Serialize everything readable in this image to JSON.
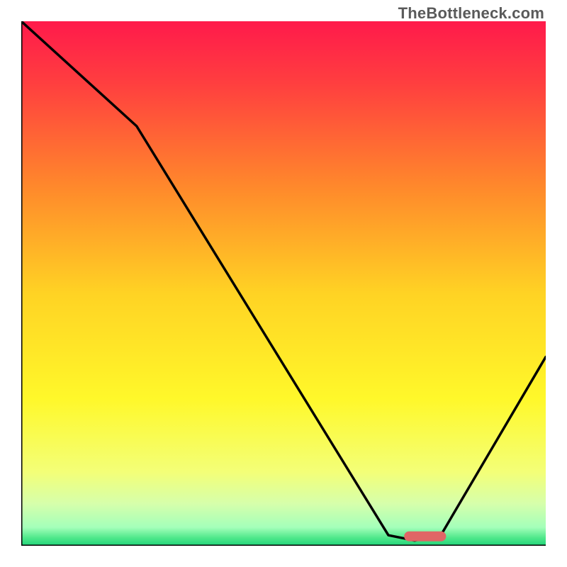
{
  "watermark": "TheBottleneck.com",
  "chart_data": {
    "type": "line",
    "title": "",
    "xlabel": "",
    "ylabel": "",
    "xlim": [
      0,
      100
    ],
    "ylim": [
      0,
      100
    ],
    "x": [
      0,
      22,
      70,
      75,
      80,
      100
    ],
    "values": [
      100,
      80,
      2,
      1,
      2,
      36
    ],
    "gradient_stops": [
      {
        "pos": 0.0,
        "color": "#ff1a4b"
      },
      {
        "pos": 0.12,
        "color": "#ff3f3f"
      },
      {
        "pos": 0.32,
        "color": "#ff8a2b"
      },
      {
        "pos": 0.52,
        "color": "#ffd324"
      },
      {
        "pos": 0.72,
        "color": "#fff82a"
      },
      {
        "pos": 0.86,
        "color": "#f3ff78"
      },
      {
        "pos": 0.92,
        "color": "#d6ffab"
      },
      {
        "pos": 0.965,
        "color": "#a4ffba"
      },
      {
        "pos": 0.985,
        "color": "#4fe88a"
      },
      {
        "pos": 1.0,
        "color": "#21d37a"
      }
    ],
    "marker": {
      "x_center": 77,
      "width": 8,
      "y": 1.8,
      "color": "#e06666"
    },
    "axis_color": "#000000",
    "axis_width": 3
  }
}
